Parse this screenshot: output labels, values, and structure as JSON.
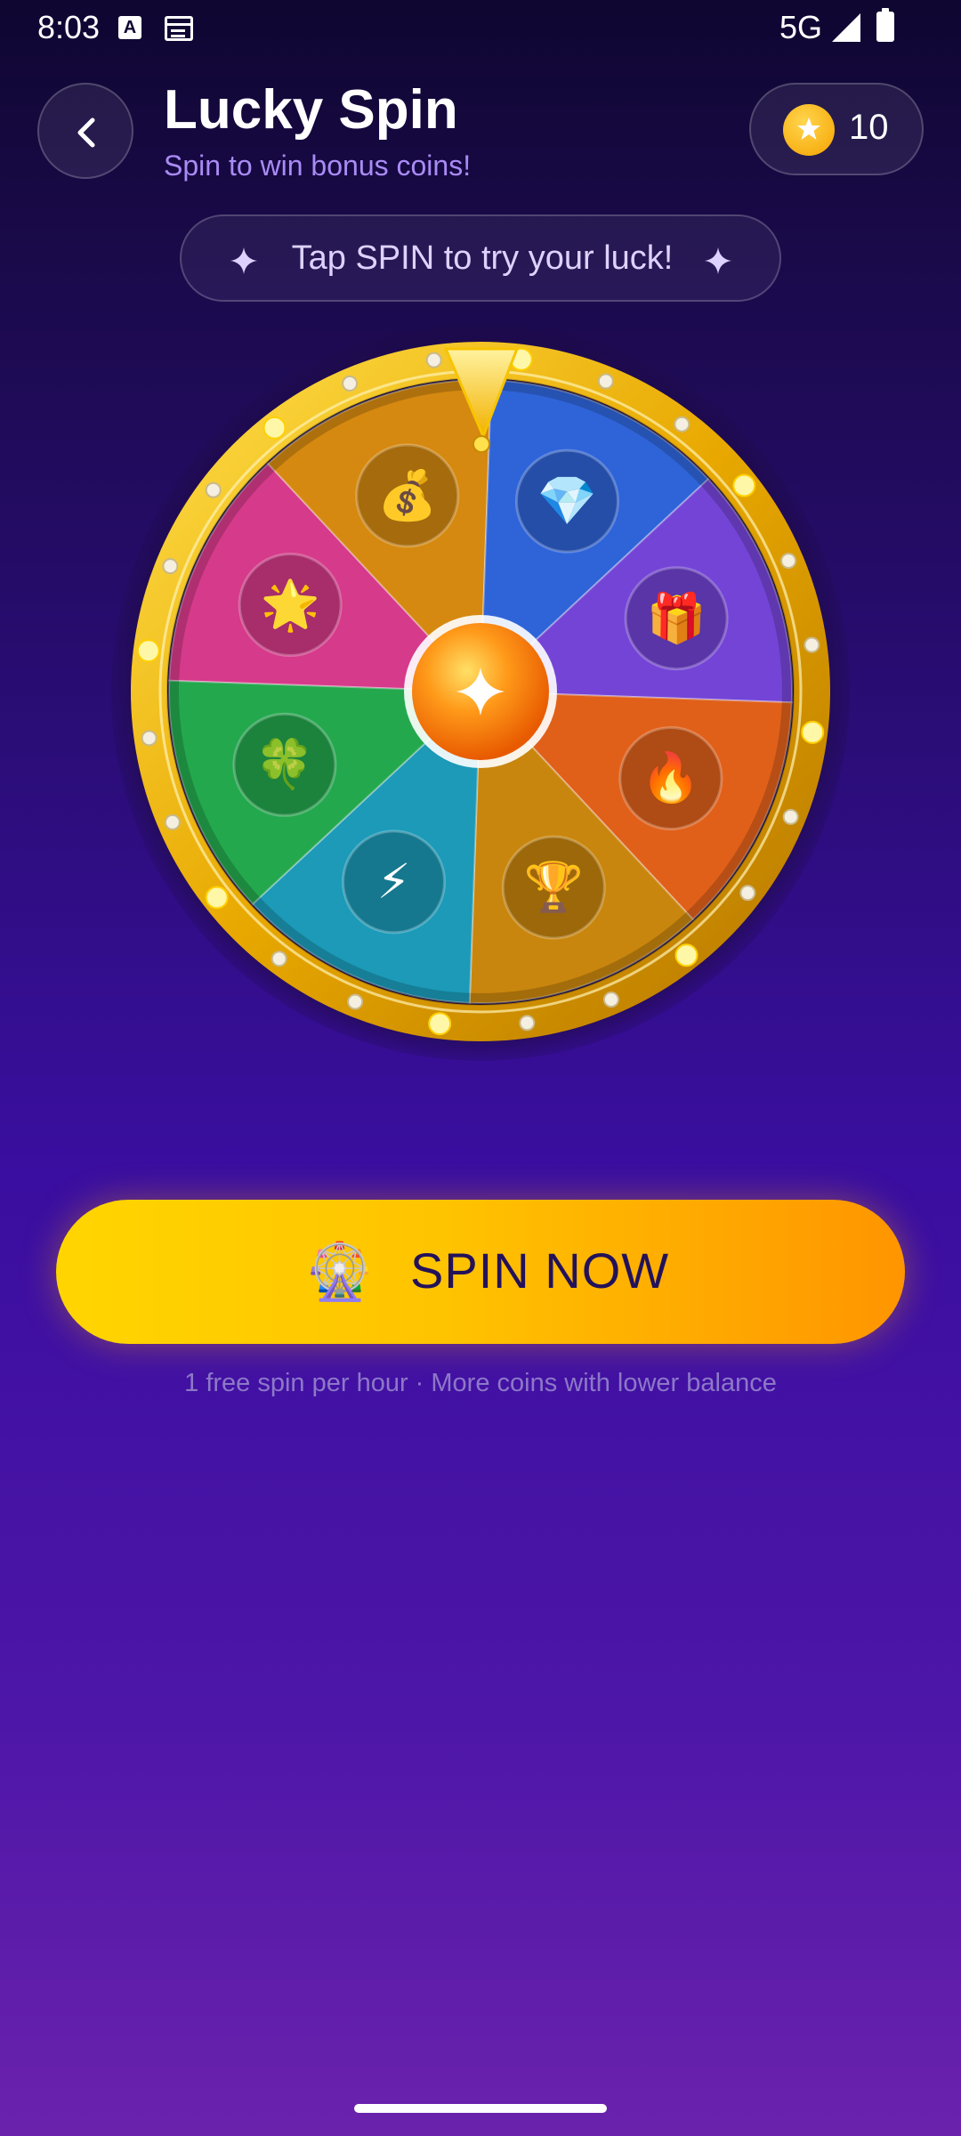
{
  "status_bar": {
    "time": "8:03",
    "network": "5G"
  },
  "header": {
    "title": "Lucky Spin",
    "subtitle": "Spin to win bonus coins!",
    "coin_balance": "10"
  },
  "hint": {
    "text": "Tap SPIN to try your luck!"
  },
  "wheel": {
    "segments": [
      {
        "icon": "star-icon",
        "emoji": "🌟",
        "color": "#d63a8a"
      },
      {
        "icon": "money-bag-icon",
        "emoji": "💰",
        "color": "#d58910"
      },
      {
        "icon": "diamond-icon",
        "emoji": "💎",
        "color": "#2f64d8"
      },
      {
        "icon": "gift-icon",
        "emoji": "🎁",
        "color": "#7444d6"
      },
      {
        "icon": "fire-icon",
        "emoji": "🔥",
        "color": "#e0601a"
      },
      {
        "icon": "trophy-icon",
        "emoji": "🏆",
        "color": "#c9860e"
      },
      {
        "icon": "lightning-icon",
        "emoji": "⚡",
        "color": "#1c9ab8"
      },
      {
        "icon": "clover-icon",
        "emoji": "🍀",
        "color": "#24a84e"
      }
    ]
  },
  "spin_button": {
    "emoji": "🎡",
    "label": "SPIN NOW"
  },
  "footer_note": "1 free spin per hour · More coins with lower balance",
  "colors": {
    "accent_gold": "#ffc400",
    "accent_orange": "#ff9500",
    "subtitle_purple": "#a98bf5"
  }
}
